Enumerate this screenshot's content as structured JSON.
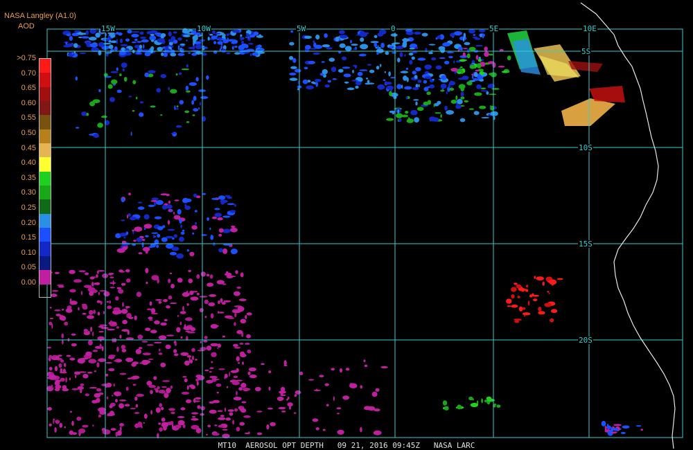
{
  "header": {
    "title": "NASA Langley (A1.0)",
    "subtitle": "AOD"
  },
  "legend": {
    "labels": [
      ">0.75",
      "0.70",
      "0.65",
      "0.60",
      "0.55",
      "0.50",
      "0.45",
      "0.40",
      "0.35",
      "0.30",
      "0.25",
      "0.20",
      "0.15",
      "0.10",
      "0.05",
      "0.00"
    ],
    "colors": [
      "#ff1a1a",
      "#d01010",
      "#a01010",
      "#801818",
      "#7a5210",
      "#b8801a",
      "#e6b450",
      "#ffff30",
      "#20d020",
      "#18a818",
      "#106a18",
      "#2a90e6",
      "#1a50ff",
      "#1428c8",
      "#0a1a80",
      "#c020a0"
    ]
  },
  "grid": {
    "lon_labels": [
      "15W",
      "10W",
      "5W",
      "0",
      "5E",
      "10E"
    ],
    "lat_labels": [
      "5S",
      "10S",
      "15S",
      "20S"
    ],
    "line_color": "#30d0d0"
  },
  "footer": {
    "text": "MT10  AEROSOL OPT DEPTH   09 21, 2016 09:45Z   NASA LARC"
  }
}
